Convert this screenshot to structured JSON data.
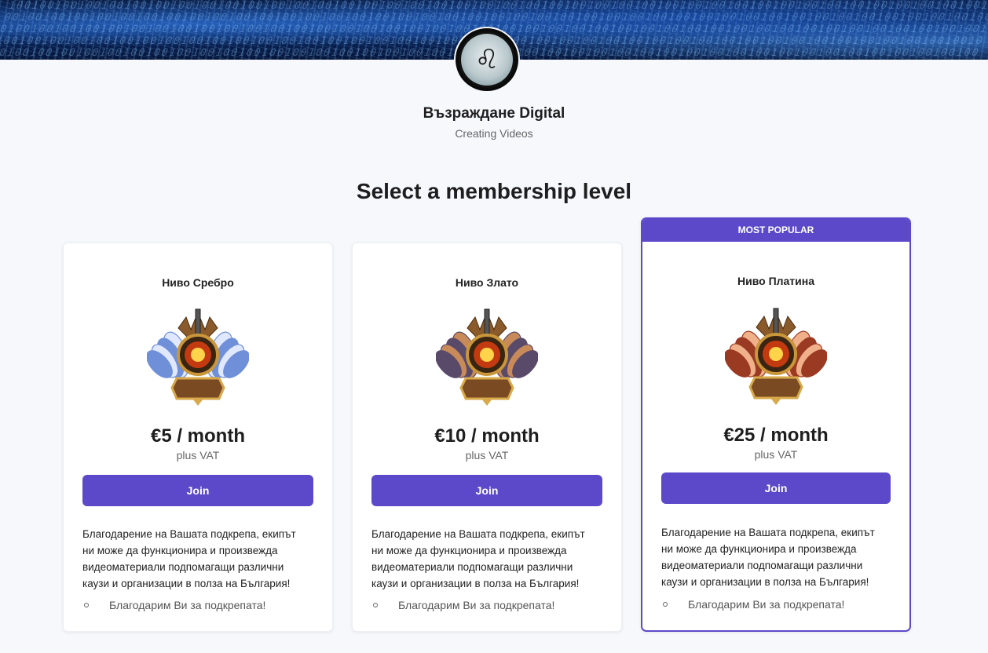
{
  "creator": {
    "name": "Възраждане Digital",
    "tagline": "Creating Videos"
  },
  "page": {
    "section_title": "Select a membership level"
  },
  "tiers": [
    {
      "name": "Ниво Сребро",
      "price": "€5 / month",
      "vat": "plus VAT",
      "join_label": "Join",
      "description": "Благодарение на Вашата подкрепа, екипът ни може да функционира и произвежда видеоматериали подпомагащи различни каузи и организации в полза на България!",
      "benefit": "Благодарим Ви за подкрепата!",
      "wing_color": "#6f8fd8",
      "wing_highlight": "#dfe8ff"
    },
    {
      "name": "Ниво Злато",
      "price": "€10 / month",
      "vat": "plus VAT",
      "join_label": "Join",
      "description": "Благодарение на Вашата подкрепа, екипът ни може да функционира и произвежда видеоматериали подпомагащи различни каузи и организации в полза на България!",
      "benefit": "Благодарим Ви за подкрепата!",
      "wing_color": "#5a4a6a",
      "wing_highlight": "#c98a5a"
    },
    {
      "name": "Ниво Платина",
      "price": "€25 / month",
      "vat": "plus VAT",
      "join_label": "Join",
      "description": "Благодарение на Вашата подкрепа, екипът ни може да функционира и произвежда видеоматериали подпомагащи различни каузи и организации в полза на България!",
      "benefit": "Благодарим Ви за подкрепата!",
      "badge": "MOST POPULAR",
      "wing_color": "#9a3a22",
      "wing_highlight": "#f0b08a"
    }
  ],
  "colors": {
    "accent": "#5b49c9",
    "background": "#f7f8fc"
  }
}
